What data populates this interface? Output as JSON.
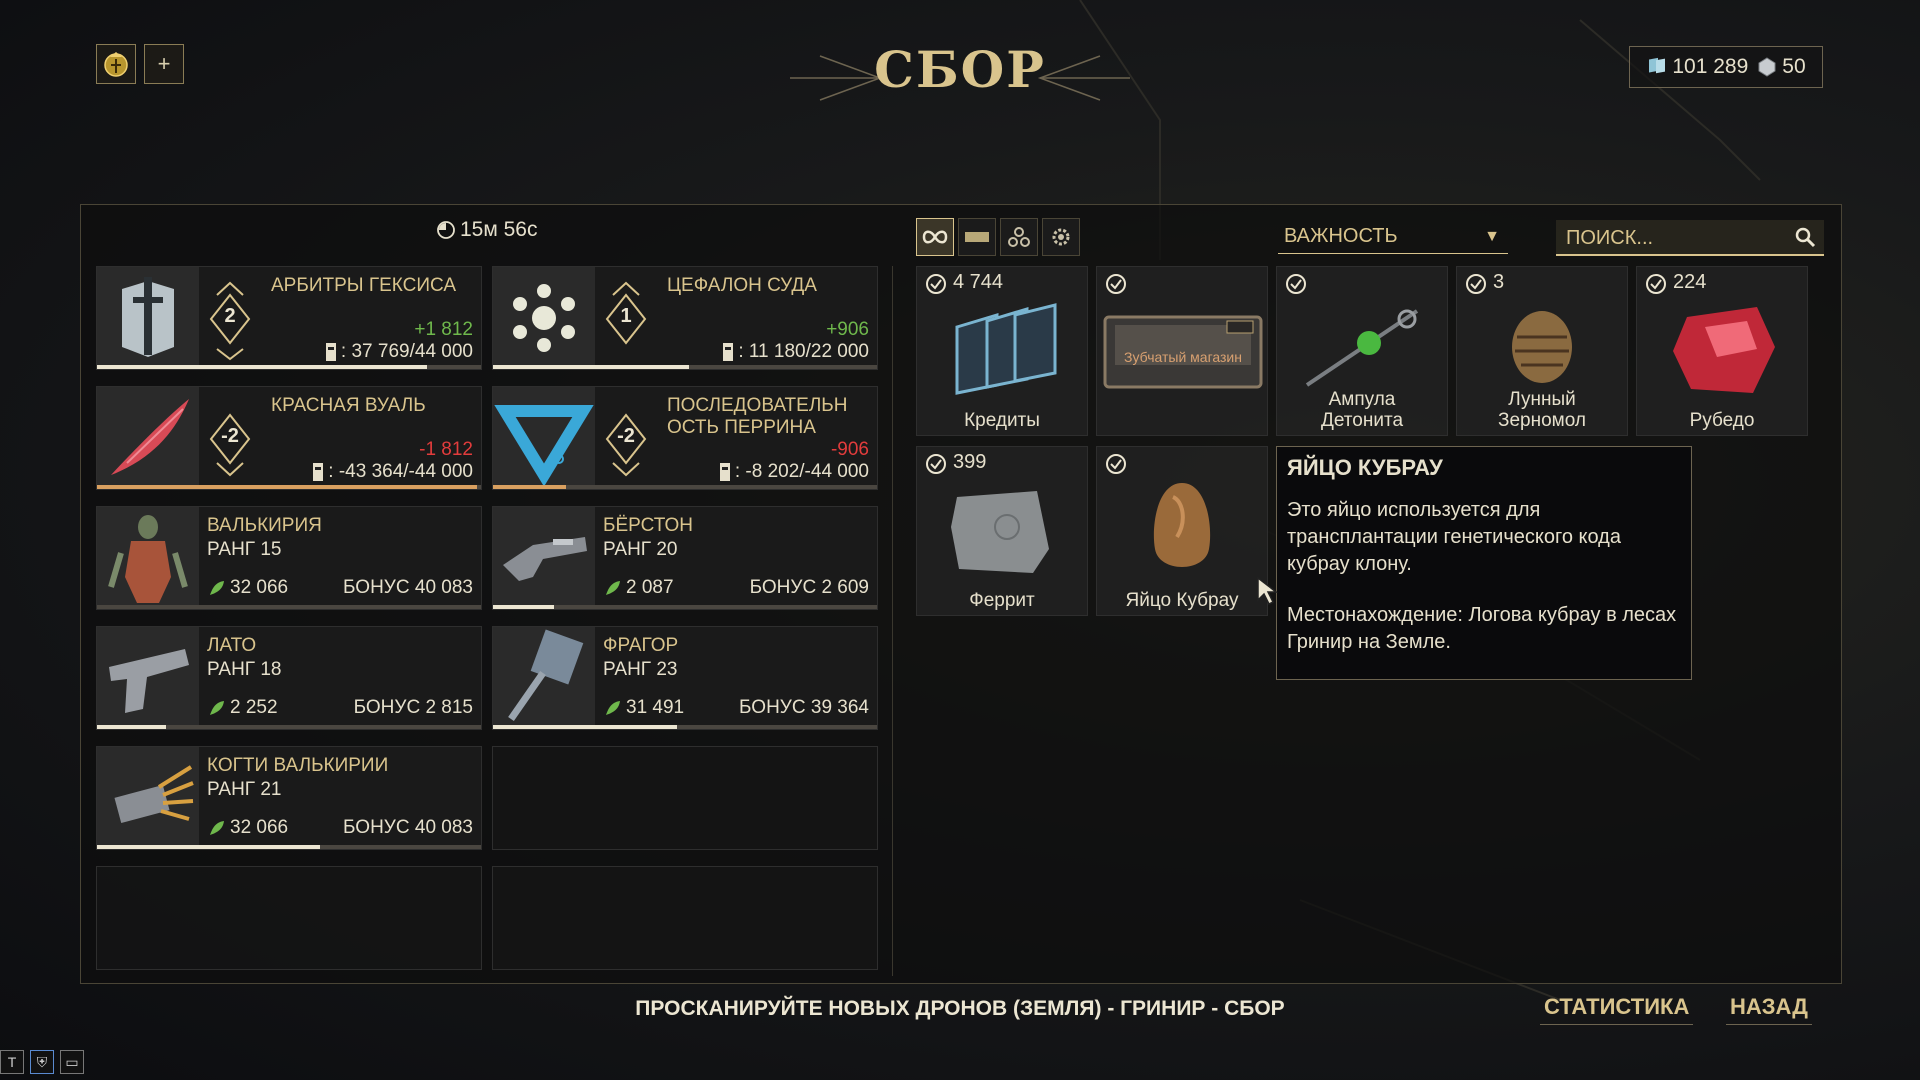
{
  "header": {
    "title": "СБОР",
    "add_label": "+",
    "currency": {
      "credits_value": "101 289",
      "platinum_value": "50"
    }
  },
  "left": {
    "timer": "15м 56с",
    "syndicates": [
      {
        "name": "АРБИТРЫ ГЕКСИСА",
        "rank": "2",
        "delta": "+1 812",
        "standing": ": 37 769/44 000",
        "progress": 0.86
      },
      {
        "name": "ЦЕФАЛОН СУДА",
        "rank": "1",
        "delta": "+906",
        "standing": ": 11 180/22 000",
        "progress": 0.51
      },
      {
        "name": "КРАСНАЯ ВУАЛЬ",
        "rank": "-2",
        "delta": "-1 812",
        "standing": ": -43 364/-44 000",
        "progress": 0.99
      },
      {
        "name": "ПОСЛЕДОВАТЕЛЬНОСТЬ ПЕРРИНА",
        "name_line1": "ПОСЛЕДОВАТЕЛЬН",
        "name_line2": "ОСТЬ ПЕРРИНА",
        "rank": "-2",
        "delta": "-906",
        "standing": ": -8 202/-44 000",
        "progress": 0.19
      }
    ],
    "equipment": [
      {
        "name": "ВАЛЬКИРИЯ",
        "rank": "РАНГ 15",
        "xp": "32 066",
        "bonus": "БОНУС 40 083",
        "progress": 0.0
      },
      {
        "name": "БЁРСТОН",
        "rank": "РАНГ 20",
        "xp": "2 087",
        "bonus": "БОНУС 2 609",
        "progress": 0.16
      },
      {
        "name": "ЛАТО",
        "rank": "РАНГ 18",
        "xp": "2 252",
        "bonus": "БОНУС 2 815",
        "progress": 0.18
      },
      {
        "name": "ФРАГОР",
        "rank": "РАНГ 23",
        "xp": "31 491",
        "bonus": "БОНУС 39 364",
        "progress": 0.48
      },
      {
        "name": "КОГТИ ВАЛЬКИРИИ",
        "rank": "РАНГ 21",
        "xp": "32 066",
        "bonus": "БОНУС 40 083",
        "progress": 0.58
      }
    ]
  },
  "right": {
    "sort": {
      "selected": "ВАЖНОСТЬ"
    },
    "search": {
      "placeholder": "ПОИСК..."
    },
    "items": [
      {
        "count": "4 744",
        "label": "Кредиты"
      },
      {
        "count": "",
        "label": "",
        "art_label": "Зубчатый магазин"
      },
      {
        "count": "",
        "label_line1": "Ампула",
        "label_line2": "Детонита"
      },
      {
        "count": "3",
        "label_line1": "Лунный",
        "label_line2": "Зерномол"
      },
      {
        "count": "224",
        "label": "Рубедо"
      },
      {
        "count": "399",
        "label": "Феррит"
      },
      {
        "count": "",
        "label": "Яйцо Кубрау"
      }
    ],
    "tooltip": {
      "title": "ЯЙЦО КУБРАУ",
      "body": "Это яйцо используется для трансплантации генетического кода кубрау клону.",
      "location": "Местонахождение: Логова кубрау в лесах Гринир на Земле."
    }
  },
  "footer": {
    "message": "ПРОСКАНИРУЙТЕ НОВЫХ ДРОНОВ (ЗЕМЛЯ) - ГРИНИР - СБОР",
    "stats_label": "СТАТИСТИКА",
    "back_label": "НАЗАД",
    "taskbar_t": "T"
  }
}
